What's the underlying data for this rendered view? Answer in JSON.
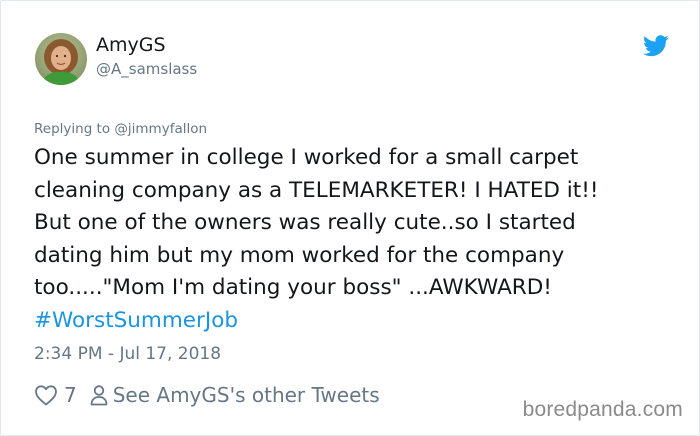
{
  "author": {
    "display_name": "AmyGS",
    "handle": "@A_samslass",
    "avatar": "avatar-photo"
  },
  "brand_icon": "twitter-bird-icon",
  "reply_context": "Replying to @jimmyfallon",
  "tweet": {
    "lines": [
      "One summer in college I worked for a small carpet",
      "cleaning company as a TELEMARKETER! I HATED it!!",
      "But one of the owners was really cute..so I started",
      "dating him but my mom worked for the company",
      "too.....\"Mom I'm dating your boss\" ...AWKWARD!"
    ],
    "hashtag": "#WorstSummerJob"
  },
  "timestamp": "2:34 PM - Jul 17, 2018",
  "actions": {
    "like_icon": "heart-icon",
    "like_count": "7",
    "profile_icon": "person-icon",
    "other_tweets_label": "See AmyGS's other Tweets"
  },
  "watermark": "boredpanda.com",
  "colors": {
    "text": "#14171a",
    "secondary": "#657786",
    "link": "#1b95e0",
    "twitter_blue": "#1da1f2",
    "border": "#e1e8ed",
    "watermark": "#8a8a8a"
  }
}
